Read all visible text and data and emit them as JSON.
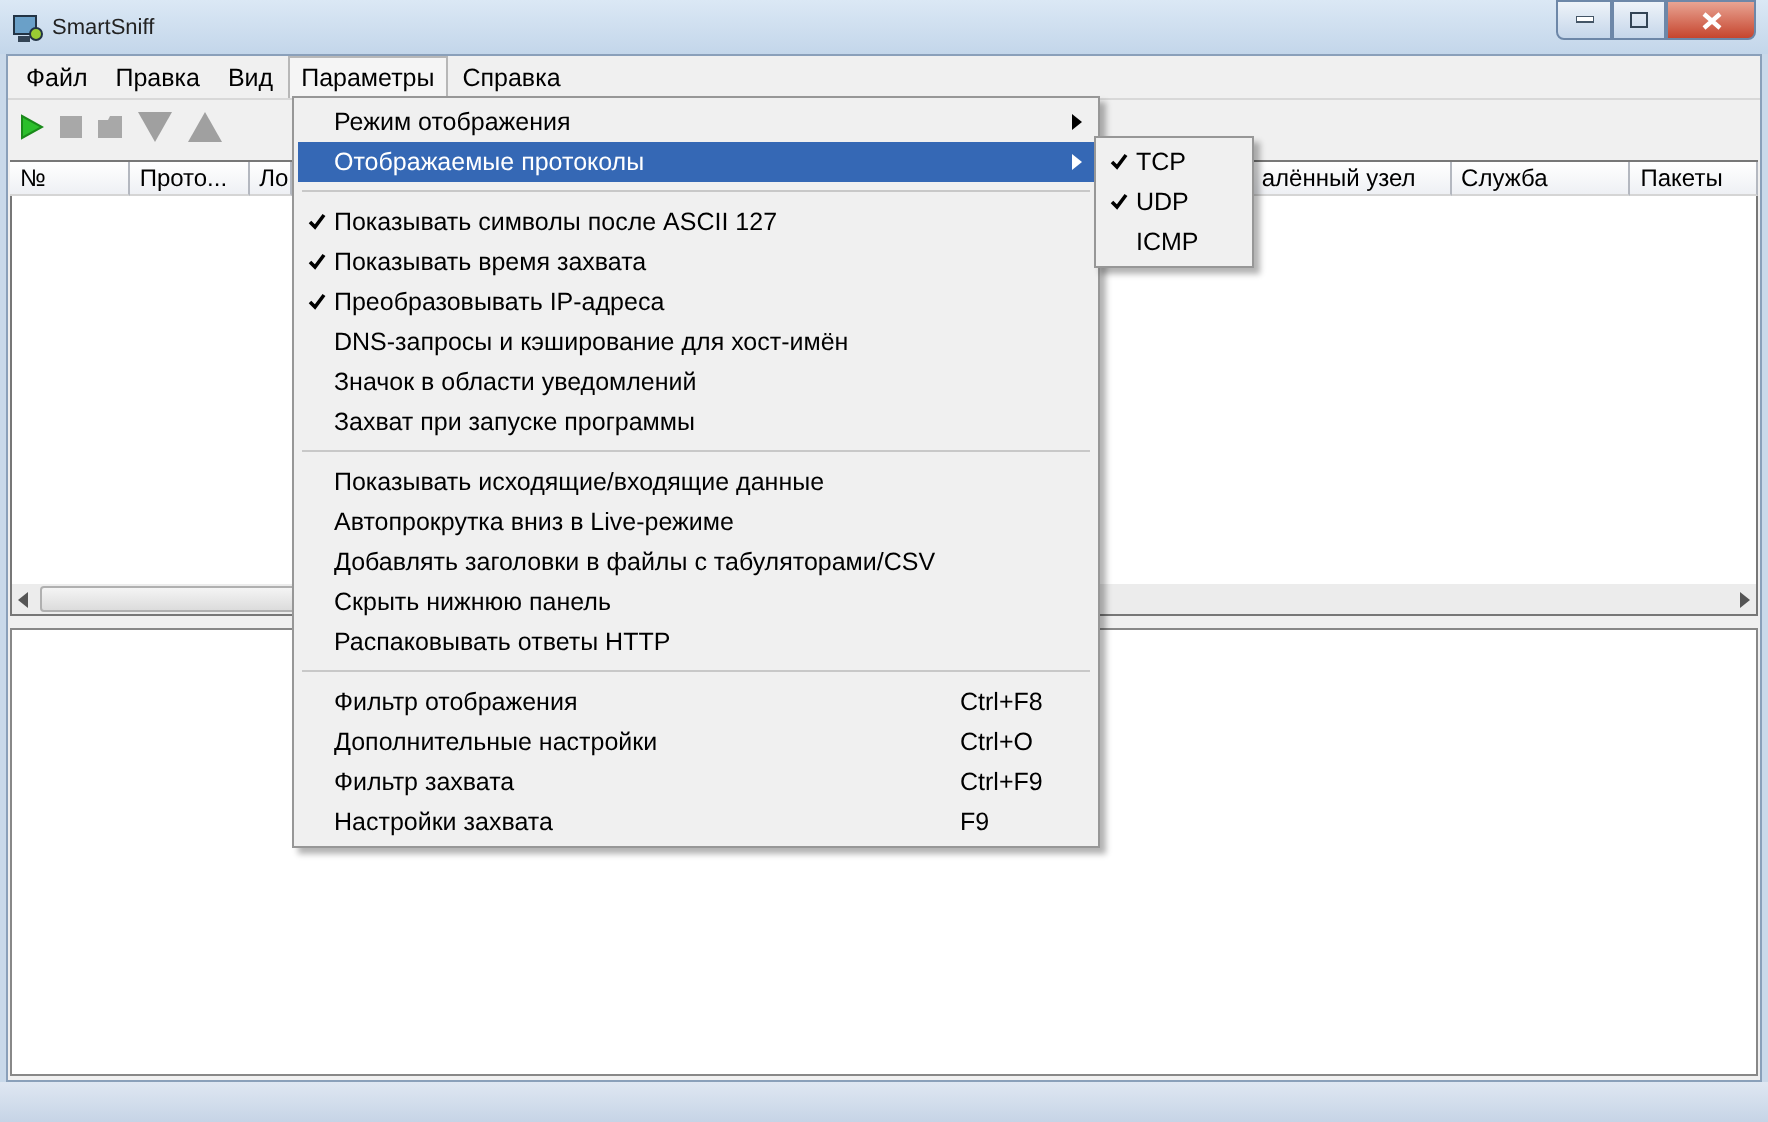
{
  "window": {
    "title": "SmartSniff"
  },
  "menubar": [
    {
      "label": "Файл",
      "selected": false
    },
    {
      "label": "Правка",
      "selected": false
    },
    {
      "label": "Вид",
      "selected": false
    },
    {
      "label": "Параметры",
      "selected": true
    },
    {
      "label": "Справка",
      "selected": false
    }
  ],
  "columns": [
    "№",
    "Прото...",
    "Ло",
    "алённый узел",
    "Служба",
    "Пакеты"
  ],
  "menu": {
    "items": [
      {
        "kind": "item",
        "label": "Режим отображения",
        "submenu": true,
        "selected": false,
        "checked": false
      },
      {
        "kind": "item",
        "label": "Отображаемые протоколы",
        "submenu": true,
        "selected": true,
        "checked": false
      },
      {
        "kind": "separator"
      },
      {
        "kind": "item",
        "label": "Показывать символы после ASCII 127",
        "checked": true,
        "selected": false
      },
      {
        "kind": "item",
        "label": "Показывать время захвата",
        "checked": true,
        "selected": false
      },
      {
        "kind": "item",
        "label": "Преобразовывать IP-адреса",
        "checked": true,
        "selected": false
      },
      {
        "kind": "item",
        "label": "DNS-запросы и кэширование для хост-имён",
        "checked": false,
        "selected": false
      },
      {
        "kind": "item",
        "label": "Значок в области уведомлений",
        "checked": false,
        "selected": false
      },
      {
        "kind": "item",
        "label": "Захват при запуске программы",
        "checked": false,
        "selected": false
      },
      {
        "kind": "separator"
      },
      {
        "kind": "item",
        "label": "Показывать исходящие/входящие данные",
        "checked": false,
        "selected": false
      },
      {
        "kind": "item",
        "label": "Автопрокрутка вниз в Live-режиме",
        "checked": false,
        "selected": false
      },
      {
        "kind": "item",
        "label": "Добавлять заголовки в файлы с табуляторами/CSV",
        "checked": false,
        "selected": false
      },
      {
        "kind": "item",
        "label": "Скрыть нижнюю панель",
        "checked": false,
        "selected": false
      },
      {
        "kind": "item",
        "label": "Распаковывать ответы HTTP",
        "checked": false,
        "selected": false
      },
      {
        "kind": "separator"
      },
      {
        "kind": "item",
        "label": "Фильтр отображения",
        "shortcut": "Ctrl+F8",
        "checked": false,
        "selected": false
      },
      {
        "kind": "item",
        "label": "Дополнительные настройки",
        "shortcut": "Ctrl+O",
        "checked": false,
        "selected": false
      },
      {
        "kind": "item",
        "label": "Фильтр захвата",
        "shortcut": "Ctrl+F9",
        "checked": false,
        "selected": false
      },
      {
        "kind": "item",
        "label": "Настройки захвата",
        "shortcut": "F9",
        "checked": false,
        "selected": false
      }
    ]
  },
  "submenu": {
    "items": [
      {
        "label": "TCP",
        "checked": true
      },
      {
        "label": "UDP",
        "checked": true
      },
      {
        "label": "ICMP",
        "checked": false
      }
    ]
  }
}
